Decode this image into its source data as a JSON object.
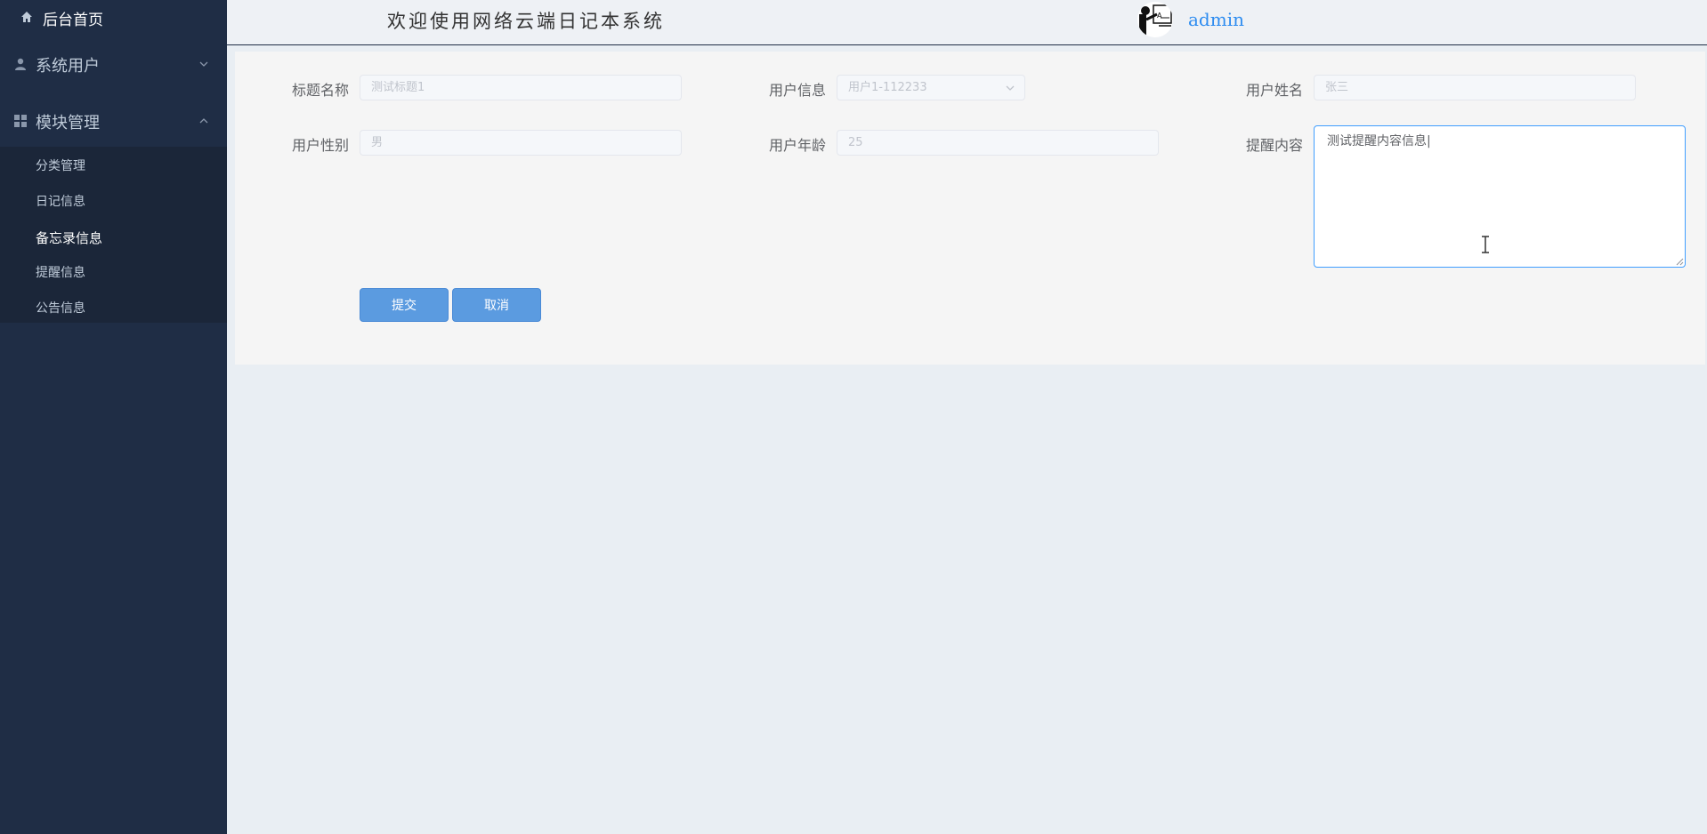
{
  "sidebar": {
    "home_label": "后台首页",
    "groups": [
      {
        "label": "系统用户",
        "expanded": false
      },
      {
        "label": "模块管理",
        "expanded": true
      }
    ],
    "items": [
      {
        "label": "分类管理",
        "active": false
      },
      {
        "label": "日记信息",
        "active": false
      },
      {
        "label": "备忘录信息",
        "active": true
      },
      {
        "label": "提醒信息",
        "active": false
      },
      {
        "label": "公告信息",
        "active": false
      }
    ]
  },
  "header": {
    "welcome": "欢迎使用网络云端日记本系统",
    "username": "admin"
  },
  "form": {
    "fields": [
      {
        "label": "标题名称",
        "value": "测试标题1"
      },
      {
        "label": "用户信息",
        "value": "用户1-112233"
      },
      {
        "label": "用户姓名",
        "value": "张三"
      },
      {
        "label": "用户性别",
        "value": "男"
      },
      {
        "label": "用户年龄",
        "value": "25"
      },
      {
        "label": "提醒内容",
        "value": "测试提醒内容信息|"
      }
    ],
    "submit_label": "提交",
    "cancel_label": "取消"
  },
  "icons": {
    "home": "home-icon",
    "user": "user-icon",
    "module": "grid-icon",
    "chevron": "chevron-icon"
  },
  "colors": {
    "sidebar_bg": "#1f2d45",
    "accent": "#2d8cf0",
    "button": "#5b9be0"
  }
}
